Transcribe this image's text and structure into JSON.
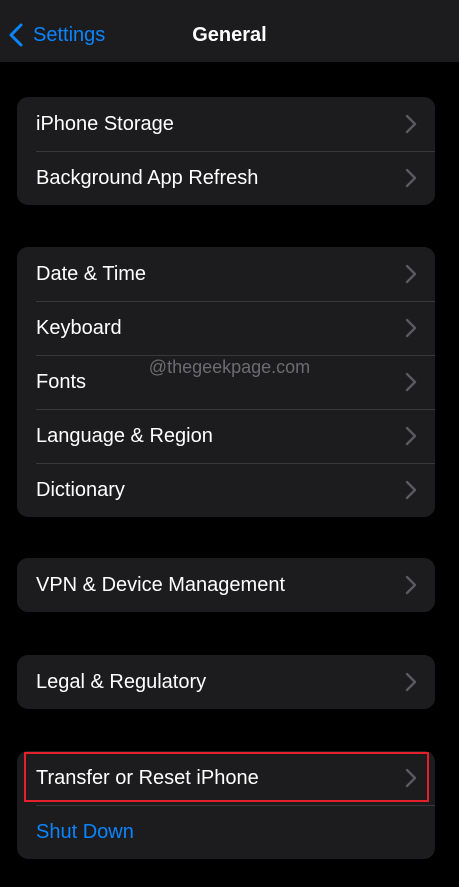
{
  "nav": {
    "back_label": "Settings",
    "title": "General"
  },
  "groups": [
    {
      "items": [
        {
          "label": "iPhone Storage"
        },
        {
          "label": "Background App Refresh"
        }
      ]
    },
    {
      "items": [
        {
          "label": "Date & Time"
        },
        {
          "label": "Keyboard"
        },
        {
          "label": "Fonts"
        },
        {
          "label": "Language & Region"
        },
        {
          "label": "Dictionary"
        }
      ]
    },
    {
      "items": [
        {
          "label": "VPN & Device Management"
        }
      ]
    },
    {
      "items": [
        {
          "label": "Legal & Regulatory"
        }
      ]
    },
    {
      "items": [
        {
          "label": "Transfer or Reset iPhone"
        },
        {
          "label": "Shut Down"
        }
      ]
    }
  ],
  "watermark": "@thegeekpage.com",
  "colors": {
    "background": "#000000",
    "group_background": "#1c1c1e",
    "accent": "#0a84ff",
    "chevron": "#5a5a5e",
    "highlight": "#e4202a"
  },
  "icons": {
    "back": "chevron-left-icon",
    "disclosure": "chevron-right-icon"
  }
}
